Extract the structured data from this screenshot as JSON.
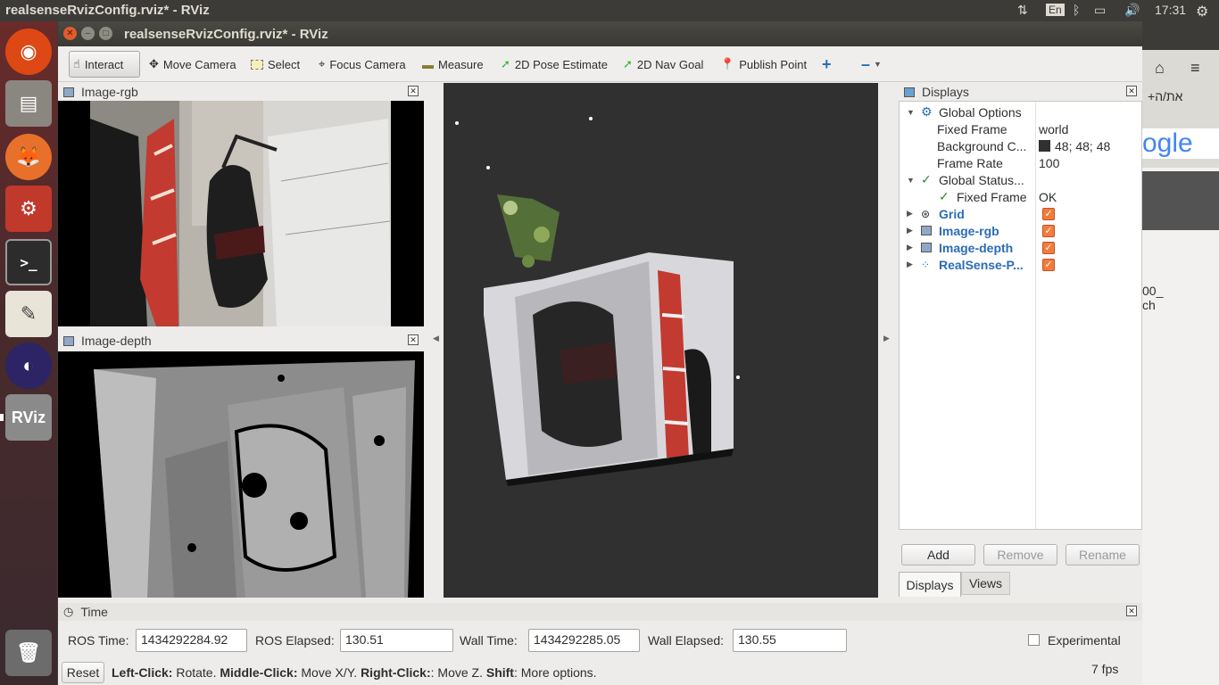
{
  "topbar": {
    "window_title": "realsenseRvizConfig.rviz* - RViz",
    "keyboard": "En",
    "clock": "17:31"
  },
  "launcher": {
    "items": [
      "ubuntu-dash",
      "files",
      "firefox",
      "system-settings",
      "terminal",
      "text-editor",
      "eclipse",
      "rviz",
      "trash"
    ]
  },
  "window": {
    "title": "realsenseRvizConfig.rviz* - RViz"
  },
  "toolbar": {
    "interact": "Interact",
    "move_camera": "Move Camera",
    "select": "Select",
    "focus_camera": "Focus Camera",
    "measure": "Measure",
    "pose_estimate": "2D Pose Estimate",
    "nav_goal": "2D Nav Goal",
    "publish_point": "Publish Point"
  },
  "panels": {
    "image_rgb": "Image-rgb",
    "image_depth": "Image-depth",
    "displays": "Displays",
    "time": "Time"
  },
  "displays": {
    "global_options": "Global Options",
    "fixed_frame_label": "Fixed Frame",
    "fixed_frame_value": "world",
    "background_label": "Background C...",
    "background_value": "48; 48; 48",
    "frame_rate_label": "Frame Rate",
    "frame_rate_value": "100",
    "global_status": "Global Status...",
    "status_fixed_frame": "Fixed Frame",
    "status_fixed_frame_value": "OK",
    "grid": "Grid",
    "image_rgb": "Image-rgb",
    "image_depth": "Image-depth",
    "realsense": "RealSense-P...",
    "add": "Add",
    "remove": "Remove",
    "rename": "Rename",
    "tab_displays": "Displays",
    "tab_views": "Views"
  },
  "time": {
    "ros_time_label": "ROS Time:",
    "ros_time": "1434292284.92",
    "ros_elapsed_label": "ROS Elapsed:",
    "ros_elapsed": "130.51",
    "wall_time_label": "Wall Time:",
    "wall_time": "1434292285.05",
    "wall_elapsed_label": "Wall Elapsed:",
    "wall_elapsed": "130.55",
    "experimental": "Experimental"
  },
  "statusbar": {
    "reset": "Reset",
    "left_click": "Left-Click:",
    "rotate": " Rotate. ",
    "middle_click": "Middle-Click:",
    "move_xy": " Move X/Y. ",
    "right_click": "Right-Click:",
    "move_z": ": Move Z. ",
    "shift": "Shift",
    "more": ": More options.",
    "fps": "7 fps"
  },
  "background_window": {
    "hebrew_link": "+את/ה",
    "logo_fragment": "ogle",
    "text1": "00_",
    "text2": "ch"
  },
  "colors": {
    "background": "#303030",
    "accent_orange": "#f27c3a",
    "link_blue": "#2a6db5"
  }
}
